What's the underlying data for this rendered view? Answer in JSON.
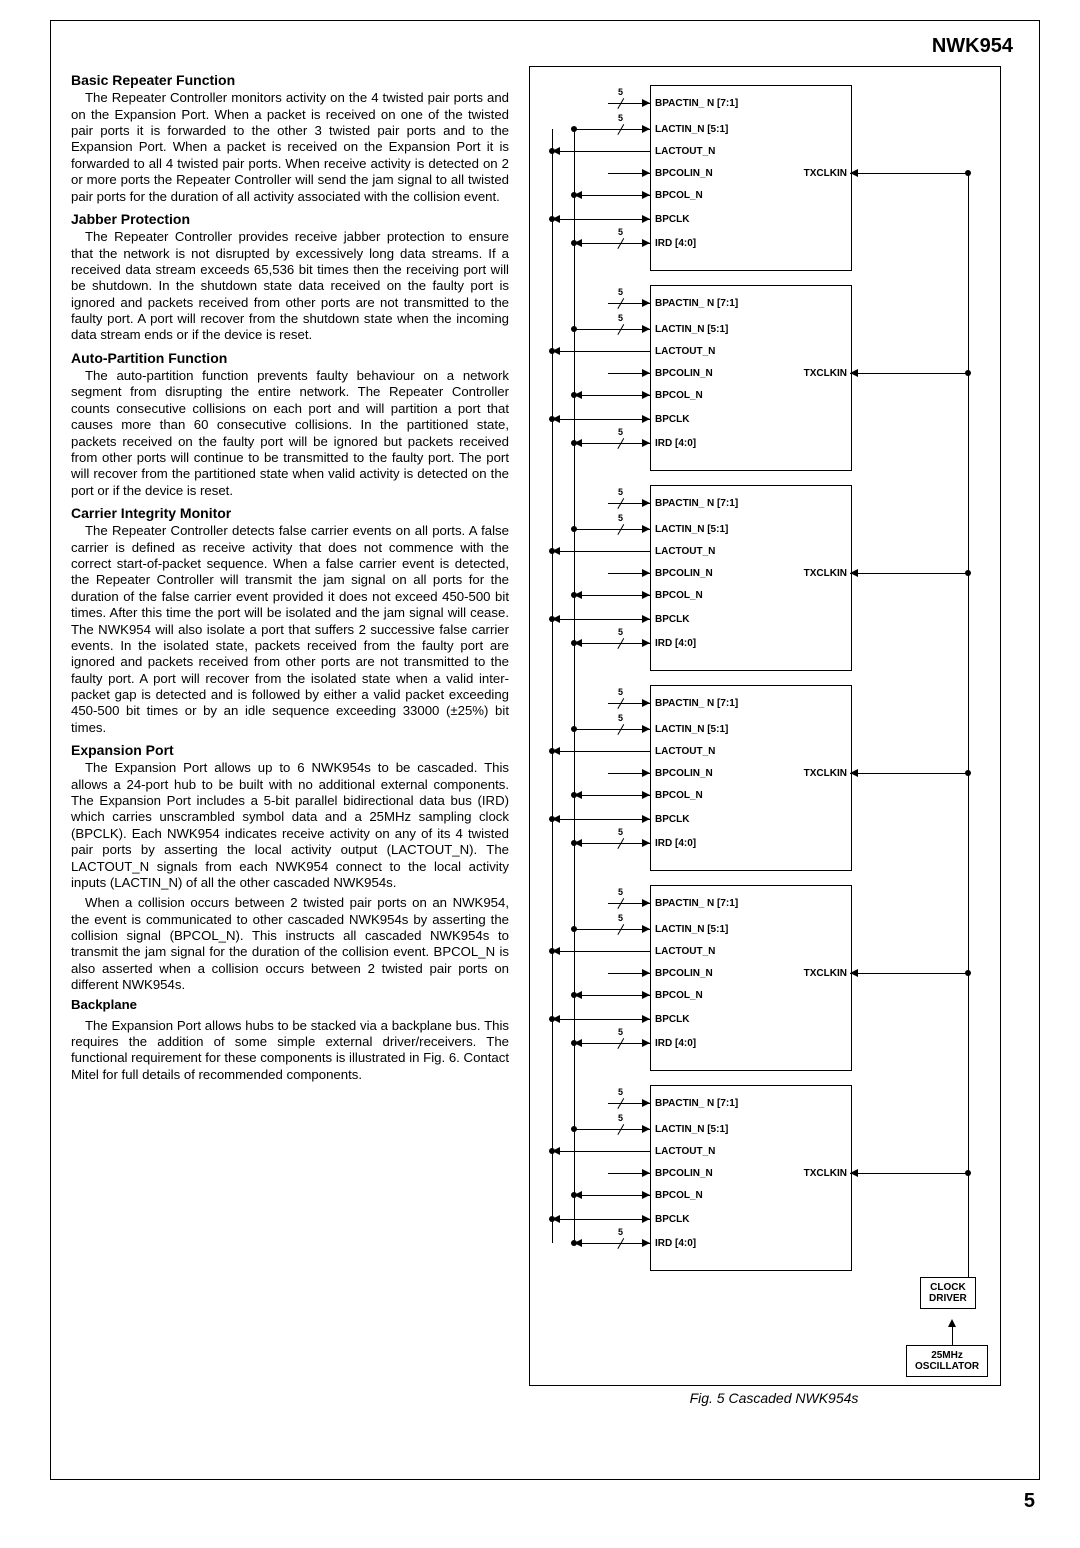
{
  "header": {
    "part_number": "NWK954"
  },
  "sections": {
    "s1_title": "Basic Repeater Function",
    "s1_body": "The Repeater Controller monitors activity on the 4 twisted pair ports and on the Expansion Port. When a packet is received on one of the twisted pair ports it is forwarded to the other 3 twisted pair ports and to the Expansion Port. When a packet is received on the Expansion Port it is forwarded to all 4 twisted pair ports. When receive activity is detected on 2 or more ports the Repeater Controller will send the jam signal to all twisted pair ports for the duration of all activity associated with the collision event.",
    "s2_title": "Jabber Protection",
    "s2_body": "The Repeater Controller provides receive jabber protection to ensure that the network is not disrupted by excessively long data streams. If a received data stream exceeds 65,536 bit times then the receiving port will be shutdown. In the shutdown state data received on the faulty port is ignored and packets received from other ports are not transmitted to the faulty port. A port will recover from the shutdown state when the incoming data stream ends or if the device is reset.",
    "s3_title": "Auto-Partition Function",
    "s3_body": "The auto-partition function prevents faulty behaviour on a network segment from disrupting the entire network. The Repeater Controller counts consecutive collisions on each port and will partition a port that causes more than 60 consecutive collisions. In the partitioned state, packets received on the faulty port will be ignored but packets received from other ports will continue to be transmitted to the faulty port. The port will recover from the partitioned state when valid activity is detected on the port or if the device is reset.",
    "s4_title": "Carrier Integrity Monitor",
    "s4_body": "The Repeater Controller detects false carrier events on all ports. A false carrier is defined as receive activity that does not commence with the correct start-of-packet sequence. When a false carrier event is detected, the Repeater Controller will transmit the jam signal on all ports for the duration of the false carrier event provided it does not exceed 450-500 bit times. After this time the port will be isolated and the jam signal will cease. The NWK954 will also isolate a port that suffers 2 successive false carrier events. In the isolated state, packets received from the faulty port are ignored and packets received from other ports are not transmitted to the faulty port. A port will recover from the isolated state when a valid inter-packet gap is detected and is followed by either a valid packet exceeding 450-500 bit times or by an idle sequence exceeding 33000 (±25%) bit times.",
    "s5_title": "Expansion Port",
    "s5_body1": "The Expansion Port allows up to 6 NWK954s to be cascaded. This allows a 24-port hub to be built with no additional external components. The Expansion Port includes a 5-bit parallel bidirectional data bus (IRD) which carries unscrambled symbol data and a 25MHz sampling clock (BPCLK). Each NWK954 indicates receive activity on any of its 4 twisted pair ports by asserting the local activity output (LACTOUT_N). The LACTOUT_N signals from each NWK954 connect to the local activity inputs (LACTIN_N) of all the other cascaded NWK954s.",
    "s5_body2": "When a collision occurs between 2 twisted pair ports on an NWK954, the event is communicated to other cascaded NWK954s by asserting the collision signal (BPCOL_N). This instructs all cascaded NWK954s to transmit the jam signal for the duration of the collision event. BPCOL_N is also asserted when a collision occurs between 2 twisted pair ports on different NWK954s.",
    "s5_sub": "Backplane",
    "s5_body3": "The Expansion Port allows hubs to be stacked via a backplane bus. This requires the addition of some simple external driver/receivers. The functional requirement for these components is illustrated in Fig. 6. Contact Mitel for full details of recommended components."
  },
  "diagram": {
    "signals": [
      "BPACTIN_ N [7:1]",
      "LACTIN_N [5:1]",
      "LACTOUT_N",
      "BPCOLIN_N",
      "BPCOL_N",
      "BPCLK",
      "IRD [4:0]"
    ],
    "right_signal": "TXCLKIN",
    "slash_top": "5",
    "slash_bot": "5",
    "clock_driver": "CLOCK\nDRIVER",
    "oscillator": "25MHz\nOSCILLATOR",
    "caption": "Fig. 5 Cascaded NWK954s"
  },
  "page_number": "5"
}
